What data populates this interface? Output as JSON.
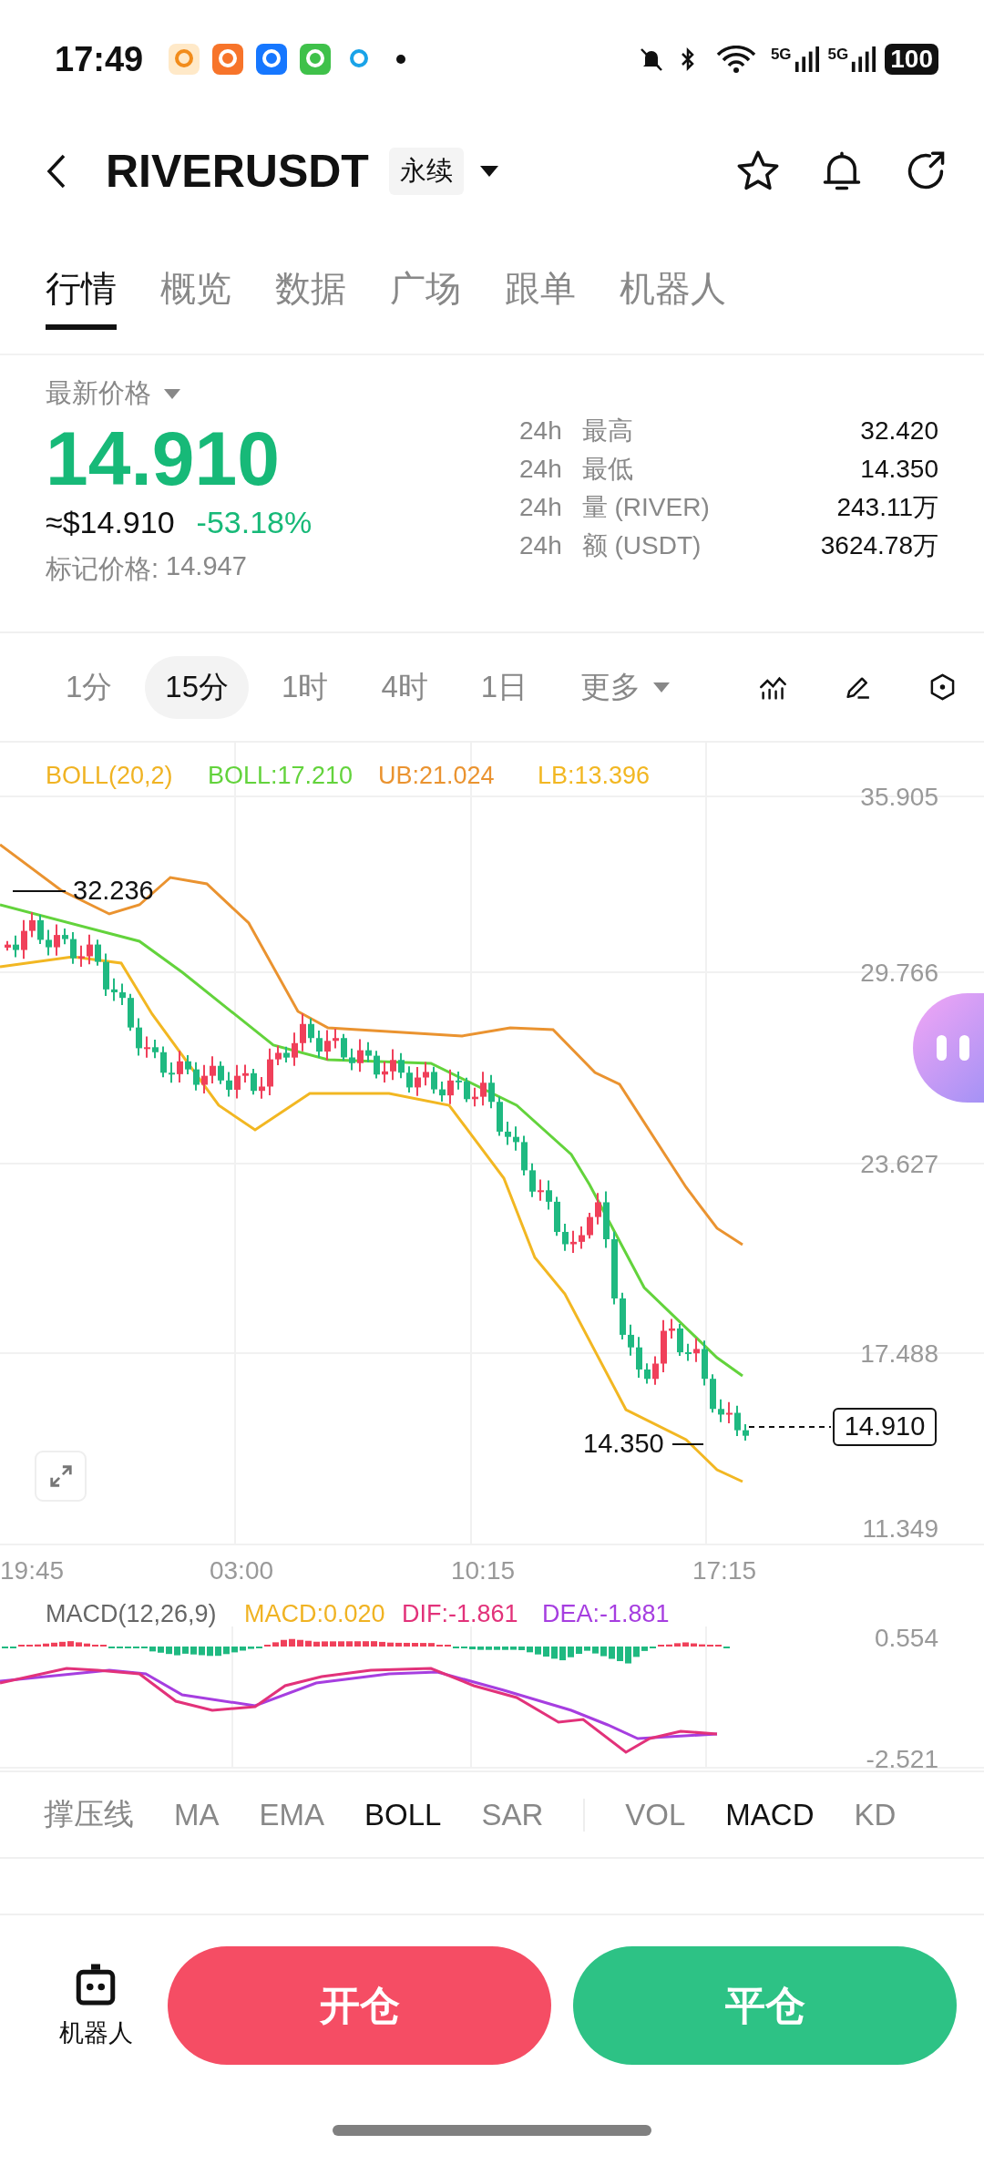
{
  "status_bar": {
    "time": "17:49",
    "network_labels": [
      "5G",
      "5G"
    ],
    "battery": "100"
  },
  "header": {
    "symbol": "RIVERUSDT",
    "contract_tag": "永续"
  },
  "tabs": [
    {
      "label": "行情",
      "selected": true
    },
    {
      "label": "概览",
      "selected": false
    },
    {
      "label": "数据",
      "selected": false
    },
    {
      "label": "广场",
      "selected": false
    },
    {
      "label": "跟单",
      "selected": false
    },
    {
      "label": "机器人",
      "selected": false
    }
  ],
  "price": {
    "label": "最新价格",
    "last": "14.910",
    "usd": "≈$14.910",
    "change": "-53.18%",
    "mark_label": "标记价格:",
    "mark": "14.947"
  },
  "stats": [
    {
      "period": "24h",
      "name": "最高",
      "value": "32.420"
    },
    {
      "period": "24h",
      "name": "最低",
      "value": "14.350"
    },
    {
      "period": "24h",
      "name": "量 (RIVER)",
      "value": "243.11万"
    },
    {
      "period": "24h",
      "name": "额 (USDT)",
      "value": "3624.78万"
    }
  ],
  "intervals": [
    {
      "label": "1分",
      "selected": false,
      "kind": "interval"
    },
    {
      "label": "15分",
      "selected": true,
      "kind": "interval"
    },
    {
      "label": "1时",
      "selected": false,
      "kind": "interval"
    },
    {
      "label": "4时",
      "selected": false,
      "kind": "interval"
    },
    {
      "label": "1日",
      "selected": false,
      "kind": "interval"
    },
    {
      "label": "更多",
      "selected": false,
      "kind": "dropdown"
    }
  ],
  "chart": {
    "legend": [
      {
        "text": "BOLL(20,2)",
        "color": "#f0b323"
      },
      {
        "text": "BOLL:17.210",
        "color": "#63d33c"
      },
      {
        "text": "UB:21.024",
        "color": "#ea9330"
      },
      {
        "text": "LB:13.396",
        "color": "#f2b722"
      }
    ],
    "y_ticks": [
      "35.905",
      "29.766",
      "23.627",
      "17.488",
      "11.349"
    ],
    "x_ticks": [
      "19:45",
      "03:00",
      "10:15",
      "17:15"
    ],
    "high_marker": "32.236",
    "low_marker": "14.350",
    "current_price": "14.910"
  },
  "macd": {
    "legend": [
      {
        "text": "MACD(12,26,9)",
        "color": "#666666"
      },
      {
        "text": "MACD:0.020",
        "color": "#f0b323"
      },
      {
        "text": "DIF:-1.861",
        "color": "#e2327a"
      },
      {
        "text": "DEA:-1.881",
        "color": "#a63ee0"
      }
    ],
    "y_ticks": [
      "0.554",
      "-2.521"
    ]
  },
  "indicators": {
    "main": [
      {
        "label": "撑压线",
        "selected": false
      },
      {
        "label": "MA",
        "selected": false
      },
      {
        "label": "EMA",
        "selected": false
      },
      {
        "label": "BOLL",
        "selected": true
      },
      {
        "label": "SAR",
        "selected": false
      }
    ],
    "sub": [
      {
        "label": "VOL",
        "selected": false
      },
      {
        "label": "MACD",
        "selected": true
      },
      {
        "label": "KD",
        "selected": false
      }
    ]
  },
  "actions": {
    "robot_label": "机器人",
    "open": "开仓",
    "close": "平仓"
  }
}
